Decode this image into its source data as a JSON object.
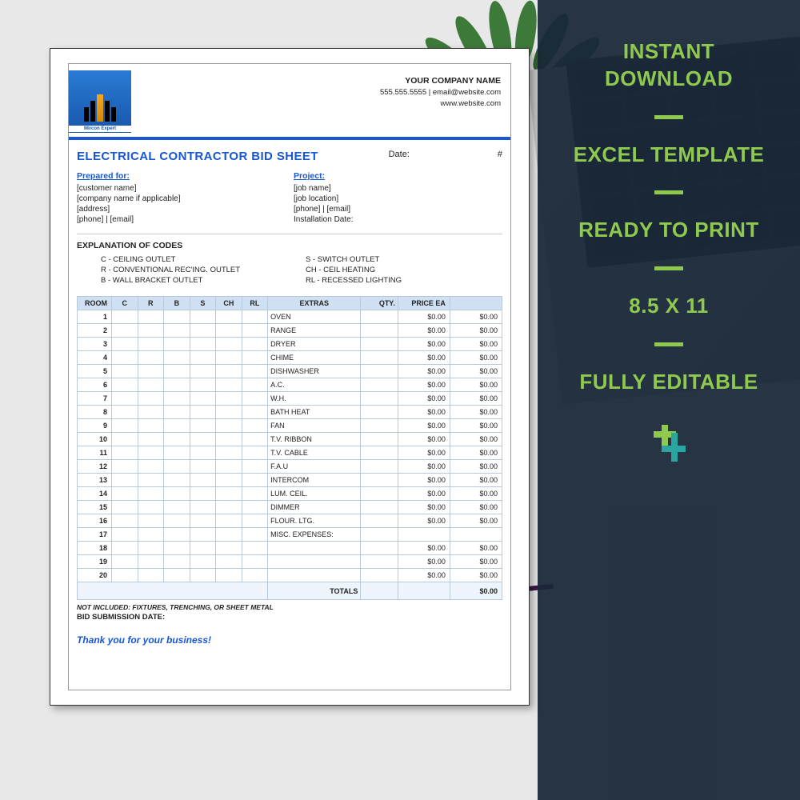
{
  "overlay": {
    "items": [
      "INSTANT DOWNLOAD",
      "EXCEL TEMPLATE",
      "READY TO PRINT",
      "8.5 X 11",
      "FULLY EDITABLE"
    ]
  },
  "doc": {
    "logo_name": "Mircon Expert",
    "company": {
      "name": "YOUR COMPANY NAME",
      "line2": "555.555.5555  |  email@website.com",
      "line3": "www.website.com"
    },
    "title": "ELECTRICAL CONTRACTOR BID SHEET",
    "date_label": "Date:",
    "hash": "#",
    "prepared": {
      "head": "Prepared for:",
      "lines": [
        "[customer name]",
        "[company name if applicable]",
        "[address]",
        "[phone]   |   [email]"
      ]
    },
    "project": {
      "head": "Project:",
      "lines": [
        "[job name]",
        "[job location]",
        "[phone]   |   [email]",
        "Installation Date:"
      ]
    },
    "codes_head": "EXPLANATION OF CODES",
    "codes_left": [
      "C  -  CEILING OUTLET",
      "R  -  CONVENTIONAL REC'ING. OUTLET",
      "B  -  WALL BRACKET OUTLET"
    ],
    "codes_right": [
      "S  -  SWITCH OUTLET",
      "CH -  CEIL HEATING",
      "RL -  RECESSED LIGHTING"
    ],
    "table": {
      "headers": [
        "ROOM",
        "C",
        "R",
        "B",
        "S",
        "CH",
        "RL",
        "EXTRAS",
        "QTY.",
        "PRICE EA",
        ""
      ],
      "extras": [
        "OVEN",
        "RANGE",
        "DRYER",
        "CHIME",
        "DISHWASHER",
        "A.C.",
        "W.H.",
        "BATH HEAT",
        "FAN",
        "T.V. RIBBON",
        "T.V. CABLE",
        "F.A.U",
        "INTERCOM",
        "LUM. CEIL.",
        "DIMMER",
        "FLOUR. LTG.",
        "MISC. EXPENSES:",
        "",
        "",
        ""
      ],
      "price": "$0.00",
      "total": "$0.00",
      "totals_label": "TOTALS",
      "totals_value": "$0.00"
    },
    "not_included": "NOT INCLUDED: FIXTURES, TRENCHING, OR SHEET METAL",
    "bid_date": "BID SUBMISSION DATE:",
    "thanks": "Thank you for your business!"
  }
}
